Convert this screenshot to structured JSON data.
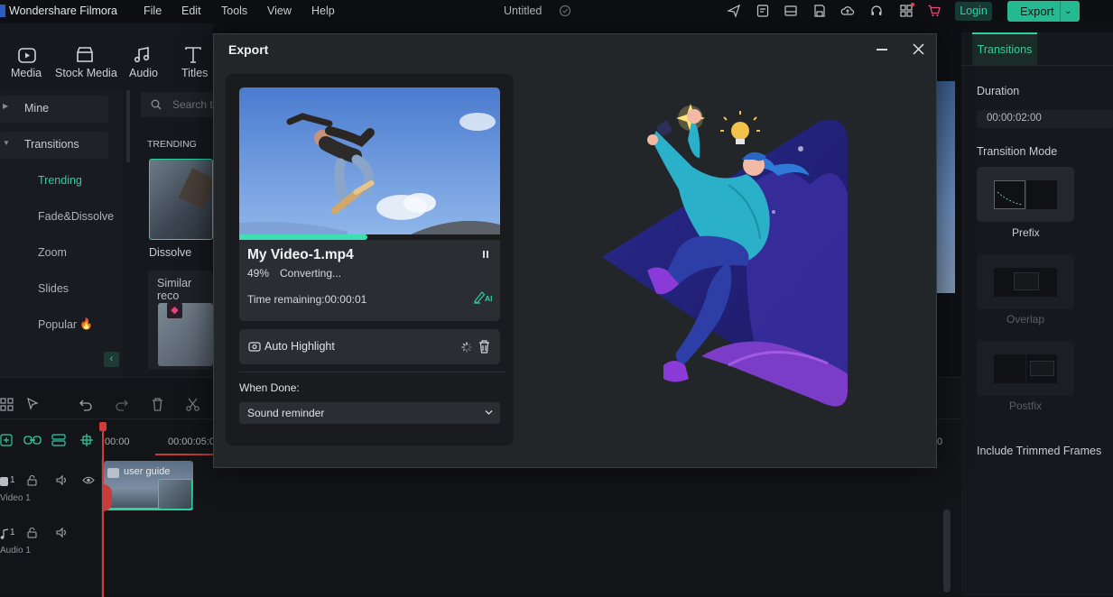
{
  "app": {
    "title": "Wondershare Filmora",
    "project": "Untitled"
  },
  "menu": [
    "File",
    "Edit",
    "Tools",
    "View",
    "Help"
  ],
  "topbar": {
    "login": "Login",
    "export": "Export"
  },
  "media_tabs": [
    "Media",
    "Stock Media",
    "Audio",
    "Titles"
  ],
  "left_nav": {
    "mine": "Mine",
    "transitions": "Transitions",
    "items": [
      "Trending",
      "Fade&Dissolve",
      "Zoom",
      "Slides",
      "Popular"
    ]
  },
  "browser": {
    "search_placeholder": "Search t",
    "section": "TRENDING",
    "thumb_label": "Dissolve",
    "similar": "Similar reco"
  },
  "timeline": {
    "time_start": "00:00",
    "time_mark": "00:00:05:0",
    "time_end": "0",
    "clip_label": "user guide",
    "video_track": "Video 1",
    "audio_track": "Audio 1",
    "track_num_video": "1",
    "track_num_audio": "1"
  },
  "right_panel": {
    "tab": "Transitions",
    "duration_label": "Duration",
    "duration_value": "00:00:02:00",
    "mode_label": "Transition Mode",
    "modes": [
      "Prefix",
      "Overlap",
      "Postfix"
    ],
    "include_trimmed": "Include Trimmed Frames"
  },
  "dialog": {
    "title": "Export",
    "file_name": "My Video-1.mp4",
    "percent": "49%",
    "status": "Converting...",
    "progress": 0.49,
    "time_remaining": "Time remaining:00:00:01",
    "ai_label": "AI",
    "auto_highlight": "Auto Highlight",
    "when_done_label": "When Done:",
    "when_done_value": "Sound reminder"
  },
  "colors": {
    "accent": "#25b992",
    "progress": "#3ee0b3",
    "bg": "#232629"
  }
}
